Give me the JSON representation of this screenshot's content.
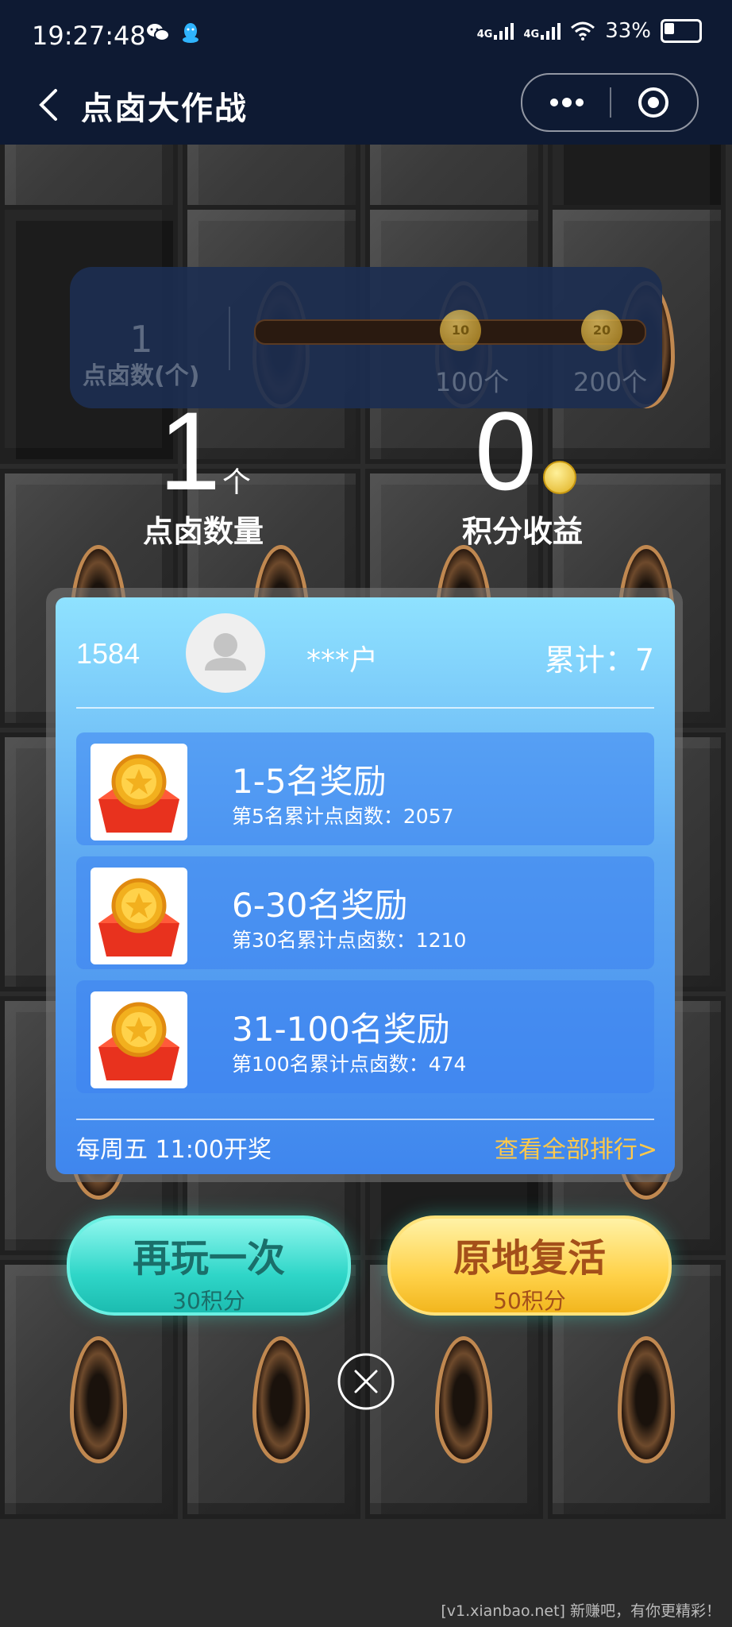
{
  "status_bar": {
    "time": "19:27:48",
    "network_1": "4G",
    "network_2": "4G",
    "battery": "33%"
  },
  "nav": {
    "title": "点卤大作战"
  },
  "progress": {
    "count": "1",
    "label": "点卤数(个)",
    "milestones": [
      {
        "badge": "10",
        "label": "100个"
      },
      {
        "badge": "20",
        "label": "200个"
      }
    ]
  },
  "stats": {
    "count_value": "1",
    "count_unit": "个",
    "count_label": "点卤数量",
    "points_value": "0",
    "points_label": "积分收益"
  },
  "leaderboard": {
    "rank": "1584",
    "username": "***户",
    "total": "累计：7",
    "rewards": [
      {
        "title": "1-5名奖励",
        "subtitle": "第5名累计点卤数：2057"
      },
      {
        "title": "6-30名奖励",
        "subtitle": "第30名累计点卤数：1210"
      },
      {
        "title": "31-100名奖励",
        "subtitle": "第100名累计点卤数：474"
      }
    ],
    "draw_time": "每周五 11:00开奖",
    "view_all": "查看全部排行>"
  },
  "buttons": {
    "replay_label": "再玩一次",
    "replay_cost": "30积分",
    "revive_label": "原地复活",
    "revive_cost": "50积分"
  },
  "watermark": "[v1.xianbao.net] 新赚吧，有你更精彩！",
  "colors": {
    "nav_bg": "#0e1a33",
    "card_top": "#8fe2ff",
    "card_bottom": "#3f86ee",
    "link": "#ffc94a",
    "replay_button": "#2fd6c8",
    "revive_button": "#ffd24a"
  }
}
